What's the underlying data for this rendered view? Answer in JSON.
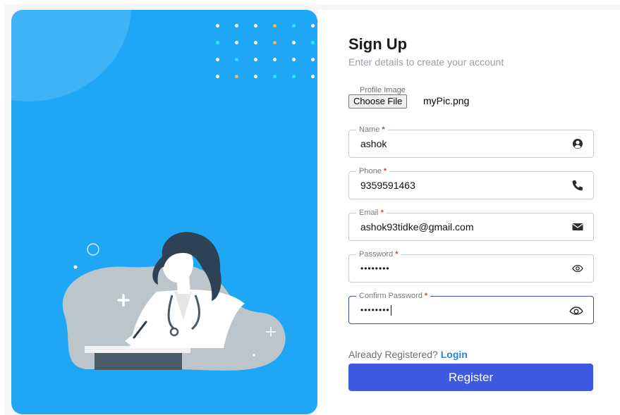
{
  "header": {
    "title": "Sign Up",
    "subtitle": "Enter details to create your account"
  },
  "profile_image": {
    "legend": "Profile Image",
    "button_label": "Choose File",
    "file_name": "myPic.png"
  },
  "fields": {
    "name": {
      "label": "Name",
      "required_mark": "*",
      "value": "ashok",
      "icon": "user-circle-icon"
    },
    "phone": {
      "label": "Phone",
      "required_mark": "*",
      "value": "9359591463",
      "icon": "phone-icon"
    },
    "email": {
      "label": "Email",
      "required_mark": "*",
      "value": "ashok93tidke@gmail.com",
      "icon": "envelope-icon"
    },
    "password": {
      "label": "Password",
      "required_mark": "*",
      "value": "••••••••",
      "icon": "eye-icon"
    },
    "confirm_password": {
      "label": "Confirm Password",
      "required_mark": "*",
      "value": "••••••••",
      "icon": "eye-icon",
      "focused": true
    }
  },
  "footer": {
    "already_text": "Already Registered?",
    "login_link": "Login",
    "register_label": "Register"
  },
  "colors": {
    "panel_blue": "#1fa7f5",
    "button_blue": "#3f5ae0",
    "link_blue": "#1e88e5",
    "required_red": "#e53935",
    "dot_white": "#ffffff",
    "dot_cyan": "#2ee6ff",
    "dot_yellow": "#f5b942"
  },
  "illustration": {
    "icon": "doctor-illustration"
  }
}
